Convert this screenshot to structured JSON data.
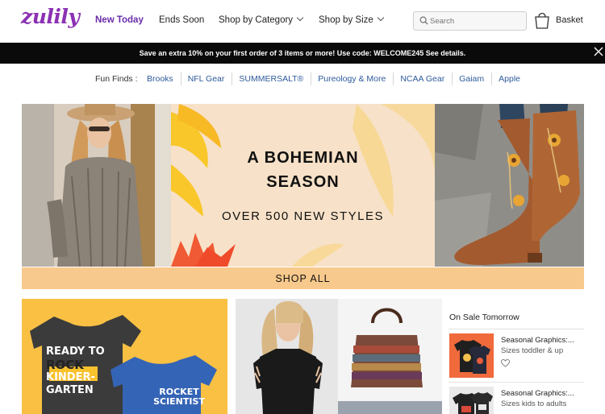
{
  "header": {
    "logo": "zulily",
    "nav": [
      {
        "label": "New Today"
      },
      {
        "label": "Ends Soon"
      },
      {
        "label": "Shop by Category"
      },
      {
        "label": "Shop by Size"
      }
    ],
    "search_placeholder": "Search",
    "basket_label": "Basket"
  },
  "promo": {
    "text": "Save an extra 10% on your first order of 3 items or more! Use code: WELCOME245 See details."
  },
  "fun_finds": {
    "label": "Fun Finds :",
    "links": [
      "Brooks",
      "NFL Gear",
      "SUMMERSALT®",
      "Pureology & More",
      "NCAA Gear",
      "Gaiam",
      "Apple"
    ]
  },
  "hero": {
    "title_line1": "A BOHEMIAN",
    "title_line2": "SEASON",
    "subtitle": "OVER 500 NEW STYLES",
    "cta": "SHOP ALL"
  },
  "cards": {
    "card1_text_lines": [
      "READY TO",
      "ROCK",
      "KINDER-",
      "GARTEN"
    ],
    "card1_shirt2_lines": [
      "ROCKET",
      "SCIENTIST"
    ]
  },
  "on_sale": {
    "title": "On Sale Tomorrow",
    "items": [
      {
        "name": "Seasonal Graphics:...",
        "desc": "Sizes toddler & up"
      },
      {
        "name": "Seasonal Graphics:...",
        "desc": "Sizes kids to adults"
      }
    ]
  },
  "colors": {
    "brand": "#8b31b3",
    "nav_active": "#6a2ba8",
    "link": "#2d5a9b",
    "promo_bg": "#0a0a0a",
    "cta_bg": "#f8c98c",
    "card1_bg": "#f9c043"
  }
}
